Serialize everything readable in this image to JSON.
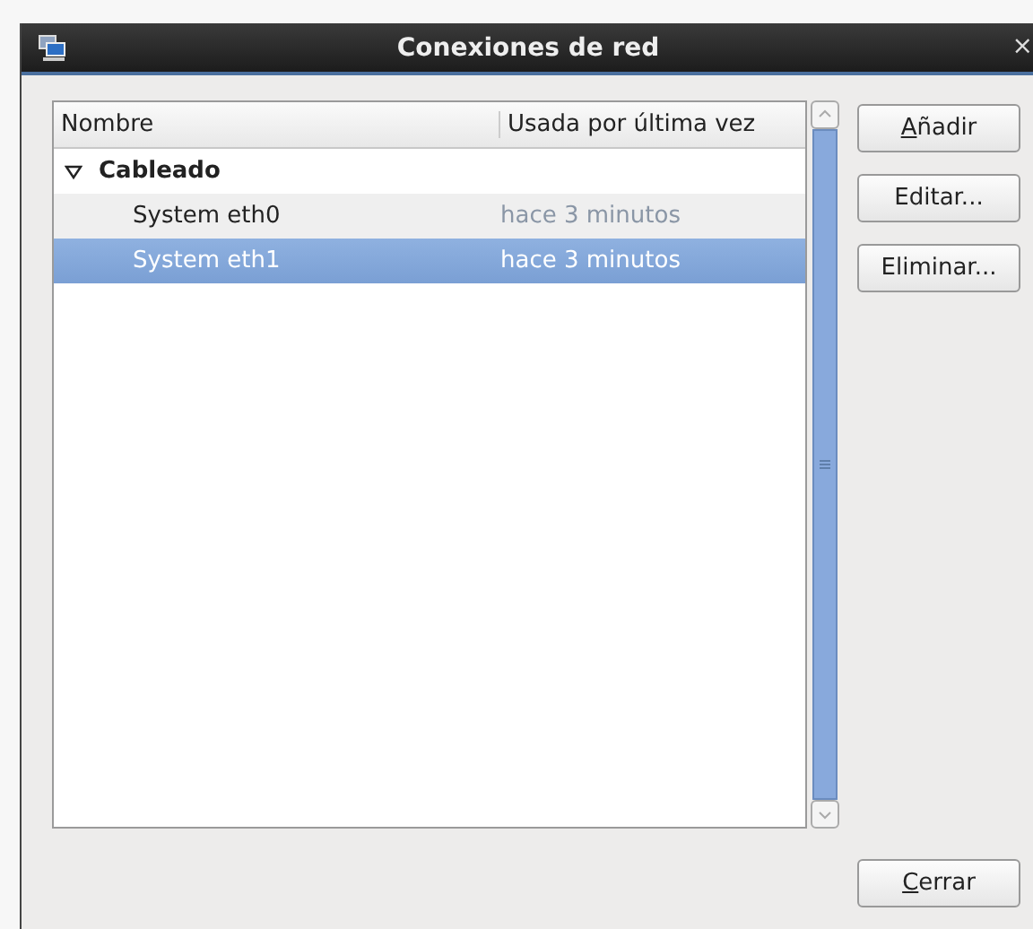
{
  "window": {
    "title": "Conexiones de red",
    "close": "×"
  },
  "table": {
    "columns": [
      "Nombre",
      "Usada por última vez"
    ],
    "groups": [
      {
        "label": "Cableado",
        "expanded": true,
        "children": [
          {
            "name": "System eth0",
            "last_used": "hace 3 minutos",
            "selected": false
          },
          {
            "name": "System eth1",
            "last_used": "hace 3 minutos",
            "selected": true
          }
        ]
      }
    ]
  },
  "buttons": [
    {
      "label": "Añadir",
      "mnemonic_first": true
    },
    {
      "label": "Editar...",
      "mnemonic_first": false
    },
    {
      "label": "Eliminar...",
      "mnemonic_first": false
    }
  ],
  "close_button": {
    "label": "Cerrar",
    "mnemonic_first": true
  }
}
